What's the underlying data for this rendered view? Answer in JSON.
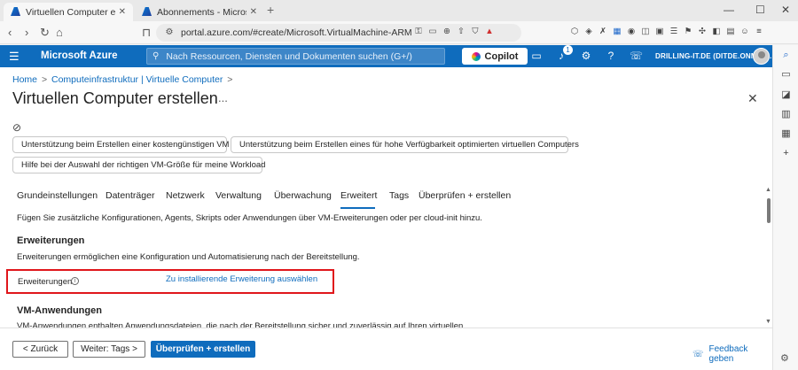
{
  "browser": {
    "tabs": [
      {
        "title": "Virtuellen Computer erstellen",
        "icon": "azure-logo"
      },
      {
        "title": "Abonnements - Microsoft Azure",
        "icon": "azure-logo"
      }
    ],
    "url": "portal.azure.com/#create/Microsoft.VirtualMachine-ARM"
  },
  "azure_header": {
    "brand": "Microsoft Azure",
    "search_placeholder": "Nach Ressourcen, Diensten und Dokumenten suchen (G+/)",
    "copilot": "Copilot",
    "notification_count": "1",
    "tenant": "DRILLING-IT.DE (DITDE.ONMICR..."
  },
  "breadcrumb": {
    "home": "Home",
    "item1": "Computeinfrastruktur | Virtuelle Computer",
    "separator": ">"
  },
  "page": {
    "title": "Virtuellen Computer erstellen",
    "more": "...",
    "close": "✕"
  },
  "assist_buttons": [
    "Unterstützung beim Erstellen einer kostengünstigen VM",
    "Unterstützung beim Erstellen eines für hohe Verfügbarkeit optimierten virtuellen Computers",
    "Hilfe bei der Auswahl der richtigen VM-Größe für meine Workload"
  ],
  "tabs": [
    "Grundeinstellungen",
    "Datenträger",
    "Netzwerk",
    "Verwaltung",
    "Überwachung",
    "Erweitert",
    "Tags",
    "Überprüfen + erstellen"
  ],
  "active_tab": "Erweitert",
  "content": {
    "description": "Fügen Sie zusätzliche Konfigurationen, Agents, Skripts oder Anwendungen über VM-Erweiterungen oder per cloud-init hinzu.",
    "extensions_heading": "Erweiterungen",
    "extensions_text": "Erweiterungen ermöglichen eine Konfiguration und Automatisierung nach der Bereitstellung.",
    "extensions_label": "Erweiterungen",
    "extensions_link": "Zu installierende Erweiterung auswählen",
    "vmapps_heading": "VM-Anwendungen",
    "vmapps_text": "VM-Anwendungen enthalten Anwendungsdateien, die nach der Bereitstellung sicher und zuverlässig auf Ihren virtuellen"
  },
  "footer": {
    "back": "< Zurück",
    "next": "Weiter: Tags >",
    "review": "Überprüfen + erstellen",
    "feedback": "Feedback geben"
  },
  "colors": {
    "azure_blue": "#0f6cbd",
    "highlight_red": "#e0161b"
  }
}
